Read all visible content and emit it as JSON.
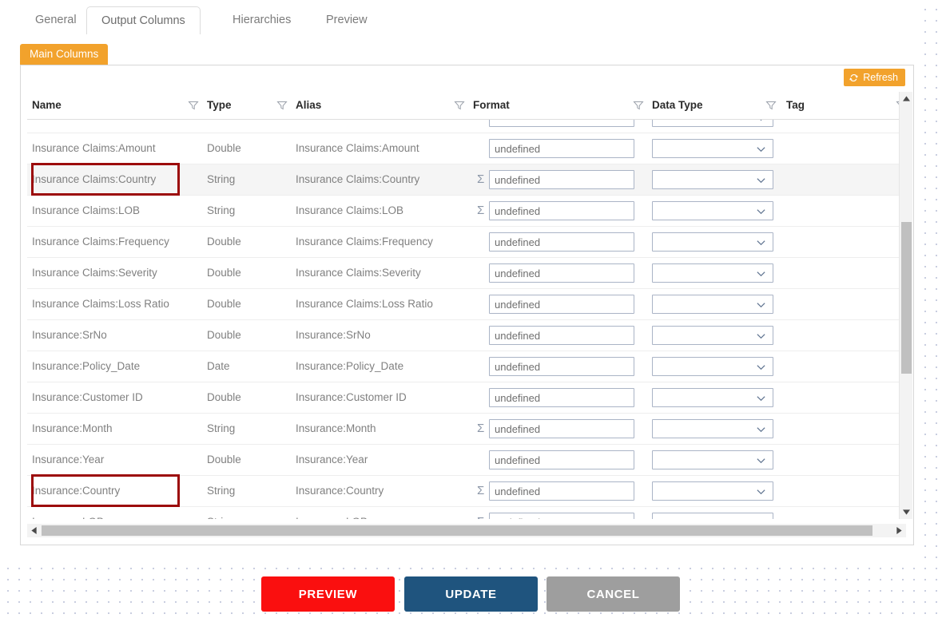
{
  "tabs": [
    {
      "label": "General",
      "active": false
    },
    {
      "label": "Output Columns",
      "active": true
    },
    {
      "label": "Hierarchies",
      "active": false
    },
    {
      "label": "Preview",
      "active": false
    }
  ],
  "subtab": {
    "label": "Main Columns"
  },
  "toolbar": {
    "refresh_label": "Refresh",
    "refresh_icon": "refresh-icon",
    "refresh_color": "#f2a22c"
  },
  "grid": {
    "columns": [
      {
        "label": "Name",
        "filter_icon": "filter-icon"
      },
      {
        "label": "Type",
        "filter_icon": "filter-icon"
      },
      {
        "label": "Alias",
        "filter_icon": "filter-icon"
      },
      {
        "label": "Format",
        "filter_icon": "filter-icon"
      },
      {
        "label": "Data Type",
        "filter_icon": "filter-icon"
      },
      {
        "label": "Tag",
        "filter_icon": "filter-icon"
      }
    ],
    "rows": [
      {
        "name": "",
        "type": "",
        "alias": "",
        "format": "",
        "sigma": false,
        "alt": false,
        "clipped": true
      },
      {
        "name": "Insurance Claims:Amount",
        "type": "Double",
        "alias": "Insurance Claims:Amount",
        "format": "undefined",
        "sigma": false,
        "alt": false
      },
      {
        "name": "Insurance Claims:Country",
        "type": "String",
        "alias": "Insurance Claims:Country",
        "format": "undefined",
        "sigma": true,
        "alt": true
      },
      {
        "name": "Insurance Claims:LOB",
        "type": "String",
        "alias": "Insurance Claims:LOB",
        "format": "undefined",
        "sigma": true,
        "alt": false
      },
      {
        "name": "Insurance Claims:Frequency",
        "type": "Double",
        "alias": "Insurance Claims:Frequency",
        "format": "undefined",
        "sigma": false,
        "alt": false
      },
      {
        "name": "Insurance Claims:Severity",
        "type": "Double",
        "alias": "Insurance Claims:Severity",
        "format": "undefined",
        "sigma": false,
        "alt": false
      },
      {
        "name": "Insurance Claims:Loss Ratio",
        "type": "Double",
        "alias": "Insurance Claims:Loss Ratio",
        "format": "undefined",
        "sigma": false,
        "alt": false
      },
      {
        "name": "Insurance:SrNo",
        "type": "Double",
        "alias": "Insurance:SrNo",
        "format": "undefined",
        "sigma": false,
        "alt": false
      },
      {
        "name": "Insurance:Policy_Date",
        "type": "Date",
        "alias": "Insurance:Policy_Date",
        "format": "undefined",
        "sigma": false,
        "alt": false
      },
      {
        "name": "Insurance:Customer ID",
        "type": "Double",
        "alias": "Insurance:Customer ID",
        "format": "undefined",
        "sigma": false,
        "alt": false
      },
      {
        "name": "Insurance:Month",
        "type": "String",
        "alias": "Insurance:Month",
        "format": "undefined",
        "sigma": true,
        "alt": false
      },
      {
        "name": "Insurance:Year",
        "type": "Double",
        "alias": "Insurance:Year",
        "format": "undefined",
        "sigma": false,
        "alt": false
      },
      {
        "name": "Insurance:Country",
        "type": "String",
        "alias": "Insurance:Country",
        "format": "undefined",
        "sigma": true,
        "alt": false
      },
      {
        "name": "Insurance:LOB",
        "type": "String",
        "alias": "Insurance:LOB",
        "format": "undefined",
        "sigma": true,
        "alt": false
      }
    ],
    "data_type_value": "",
    "tag_value": ""
  },
  "highlights": [
    {
      "target": "Insurance Claims:Country",
      "color": "#9c0b0b"
    },
    {
      "target": "Insurance:Country",
      "color": "#9c0b0b"
    }
  ],
  "footer": {
    "buttons": [
      {
        "label": "PREVIEW",
        "color": "#fa0f0f"
      },
      {
        "label": "UPDATE",
        "color": "#1f547e"
      },
      {
        "label": "CANCEL",
        "color": "#9e9e9e"
      }
    ]
  }
}
